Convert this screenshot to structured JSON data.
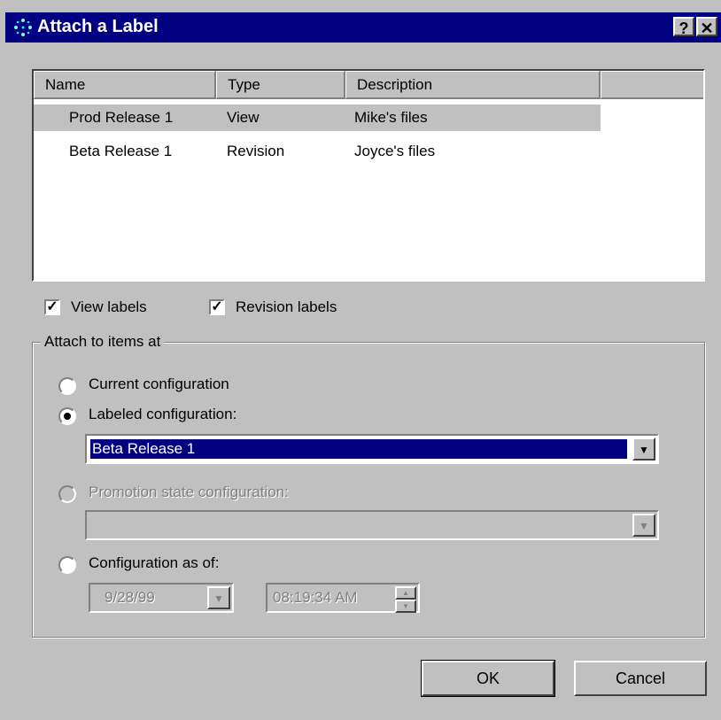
{
  "window": {
    "title": "Attach a Label",
    "help_button": "?",
    "close_button": "✕"
  },
  "list": {
    "columns": [
      "Name",
      "Type",
      "Description"
    ],
    "rows": [
      {
        "name": "Prod Release 1",
        "type": "View",
        "description": "Mike's files",
        "selected": true
      },
      {
        "name": "Beta Release 1",
        "type": "Revision",
        "description": "Joyce's files",
        "selected": false
      }
    ]
  },
  "filters": {
    "view_labels": {
      "label": "View labels",
      "checked": true
    },
    "revision_labels": {
      "label": "Revision labels",
      "checked": true
    }
  },
  "group": {
    "title": "Attach to items at",
    "current_configuration": {
      "label": "Current configuration",
      "checked": false
    },
    "labeled_configuration": {
      "label": "Labeled configuration:",
      "checked": true,
      "value": "Beta Release 1"
    },
    "promotion_state_configuration": {
      "label": "Promotion state configuration:",
      "checked": false,
      "enabled": false,
      "value": ""
    },
    "configuration_as_of": {
      "label": "Configuration as of:",
      "checked": false,
      "date": "9/28/99",
      "time": "08:19:34 AM"
    }
  },
  "buttons": {
    "ok": "OK",
    "cancel": "Cancel"
  },
  "icons": {
    "app": "sparkle-icon",
    "dropdown": "chevron-down-icon",
    "spin_up": "spin-up-icon",
    "spin_down": "spin-down-icon"
  }
}
